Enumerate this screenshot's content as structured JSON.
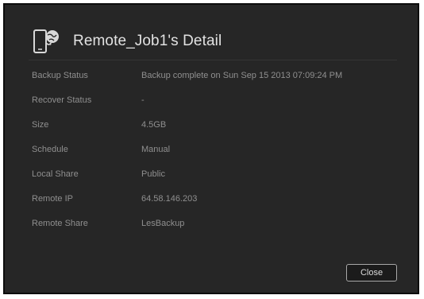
{
  "dialog": {
    "title": "Remote_Job1's Detail",
    "icon": "remote-backup-device-icon",
    "close_label": "Close"
  },
  "details": [
    {
      "label": "Backup Status",
      "value": "Backup complete on Sun Sep 15 2013 07:09:24 PM"
    },
    {
      "label": "Recover Status",
      "value": "-"
    },
    {
      "label": "Size",
      "value": "4.5GB"
    },
    {
      "label": "Schedule",
      "value": "Manual"
    },
    {
      "label": "Local Share",
      "value": "Public"
    },
    {
      "label": "Remote IP",
      "value": "64.58.146.203"
    },
    {
      "label": "Remote Share",
      "value": "LesBackup"
    }
  ],
  "colors": {
    "background": "#262626",
    "title": "#e2e2e2",
    "text": "#8f8f8f",
    "button_border": "#a8a8a8"
  }
}
